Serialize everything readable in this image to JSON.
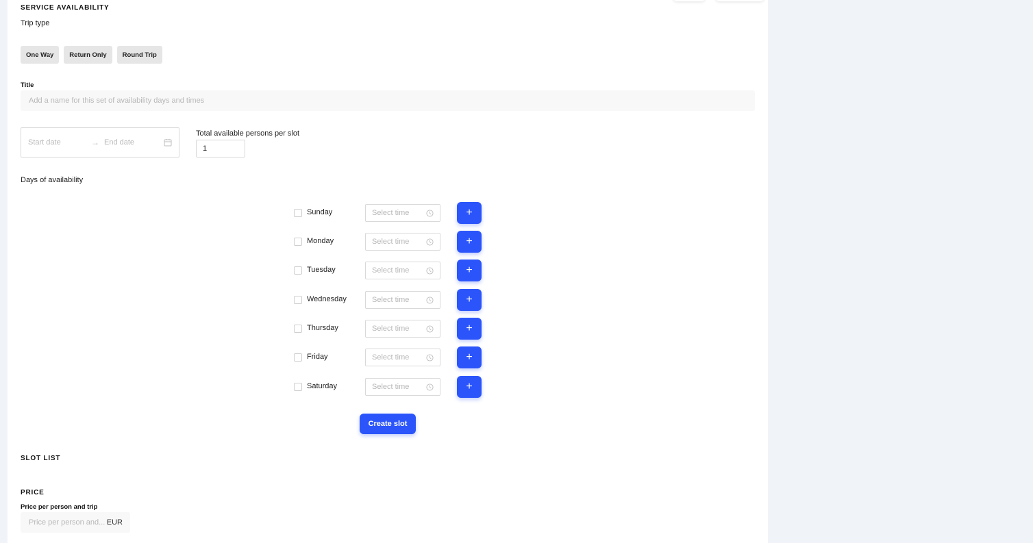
{
  "service_availability": {
    "heading": "SERVICE AVAILABILITY",
    "trip_type_label": "Trip type",
    "trip_types": [
      "One Way",
      "Return Only",
      "Round Trip"
    ],
    "title_label": "Title",
    "title_placeholder": "Add a name for this set of availability days and times",
    "start_date_placeholder": "Start date",
    "end_date_placeholder": "End date",
    "range_arrow": "→",
    "persons_label": "Total available persons per slot",
    "persons_value": "1",
    "days_label": "Days of availability",
    "days": [
      "Sunday",
      "Monday",
      "Tuesday",
      "Wednesday",
      "Thursday",
      "Friday",
      "Saturday"
    ],
    "time_placeholder": "Select time",
    "add_label": "+",
    "create_slot_label": "Create slot"
  },
  "slot_list": {
    "heading": "SLOT LIST"
  },
  "price": {
    "heading": "PRICE",
    "label": "Price per person and trip",
    "placeholder": "Price per person and...",
    "currency": "EUR"
  },
  "colors": {
    "accent": "#2b55fb",
    "page_bg": "#f0f4f9",
    "panel_bg": "#ffffff"
  },
  "icons": {
    "calendar": "calendar-icon",
    "clock": "clock-icon",
    "plus": "plus-icon",
    "arrow": "arrow-right-icon"
  }
}
